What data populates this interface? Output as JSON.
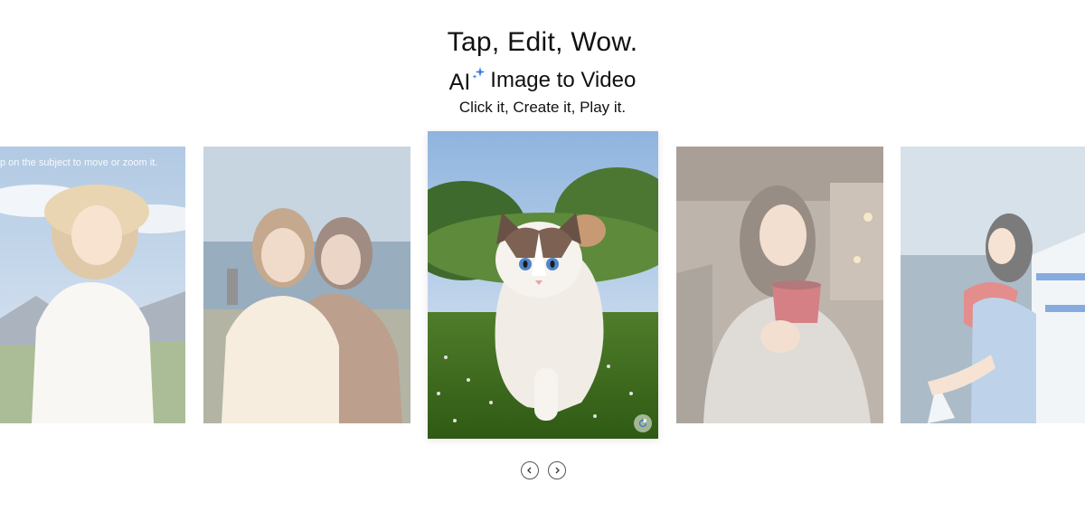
{
  "hero": {
    "headline": "Tap, Edit, Wow.",
    "ai_label": "AI",
    "subhead": "Image to Video",
    "tagline": "Click it, Create it, Play it."
  },
  "carousel": {
    "slides": [
      {
        "index": 1,
        "state": "faded",
        "hint": "p on the subject to move or zoom it."
      },
      {
        "index": 2,
        "state": "faded"
      },
      {
        "index": 3,
        "state": "active"
      },
      {
        "index": 4,
        "state": "faded"
      },
      {
        "index": 5,
        "state": "faded"
      }
    ],
    "prev_icon": "chevron-left-icon",
    "next_icon": "chevron-right-icon",
    "replay_icon": "replay-icon"
  },
  "colors": {
    "accent": "#3b7de8",
    "text": "#111111"
  }
}
